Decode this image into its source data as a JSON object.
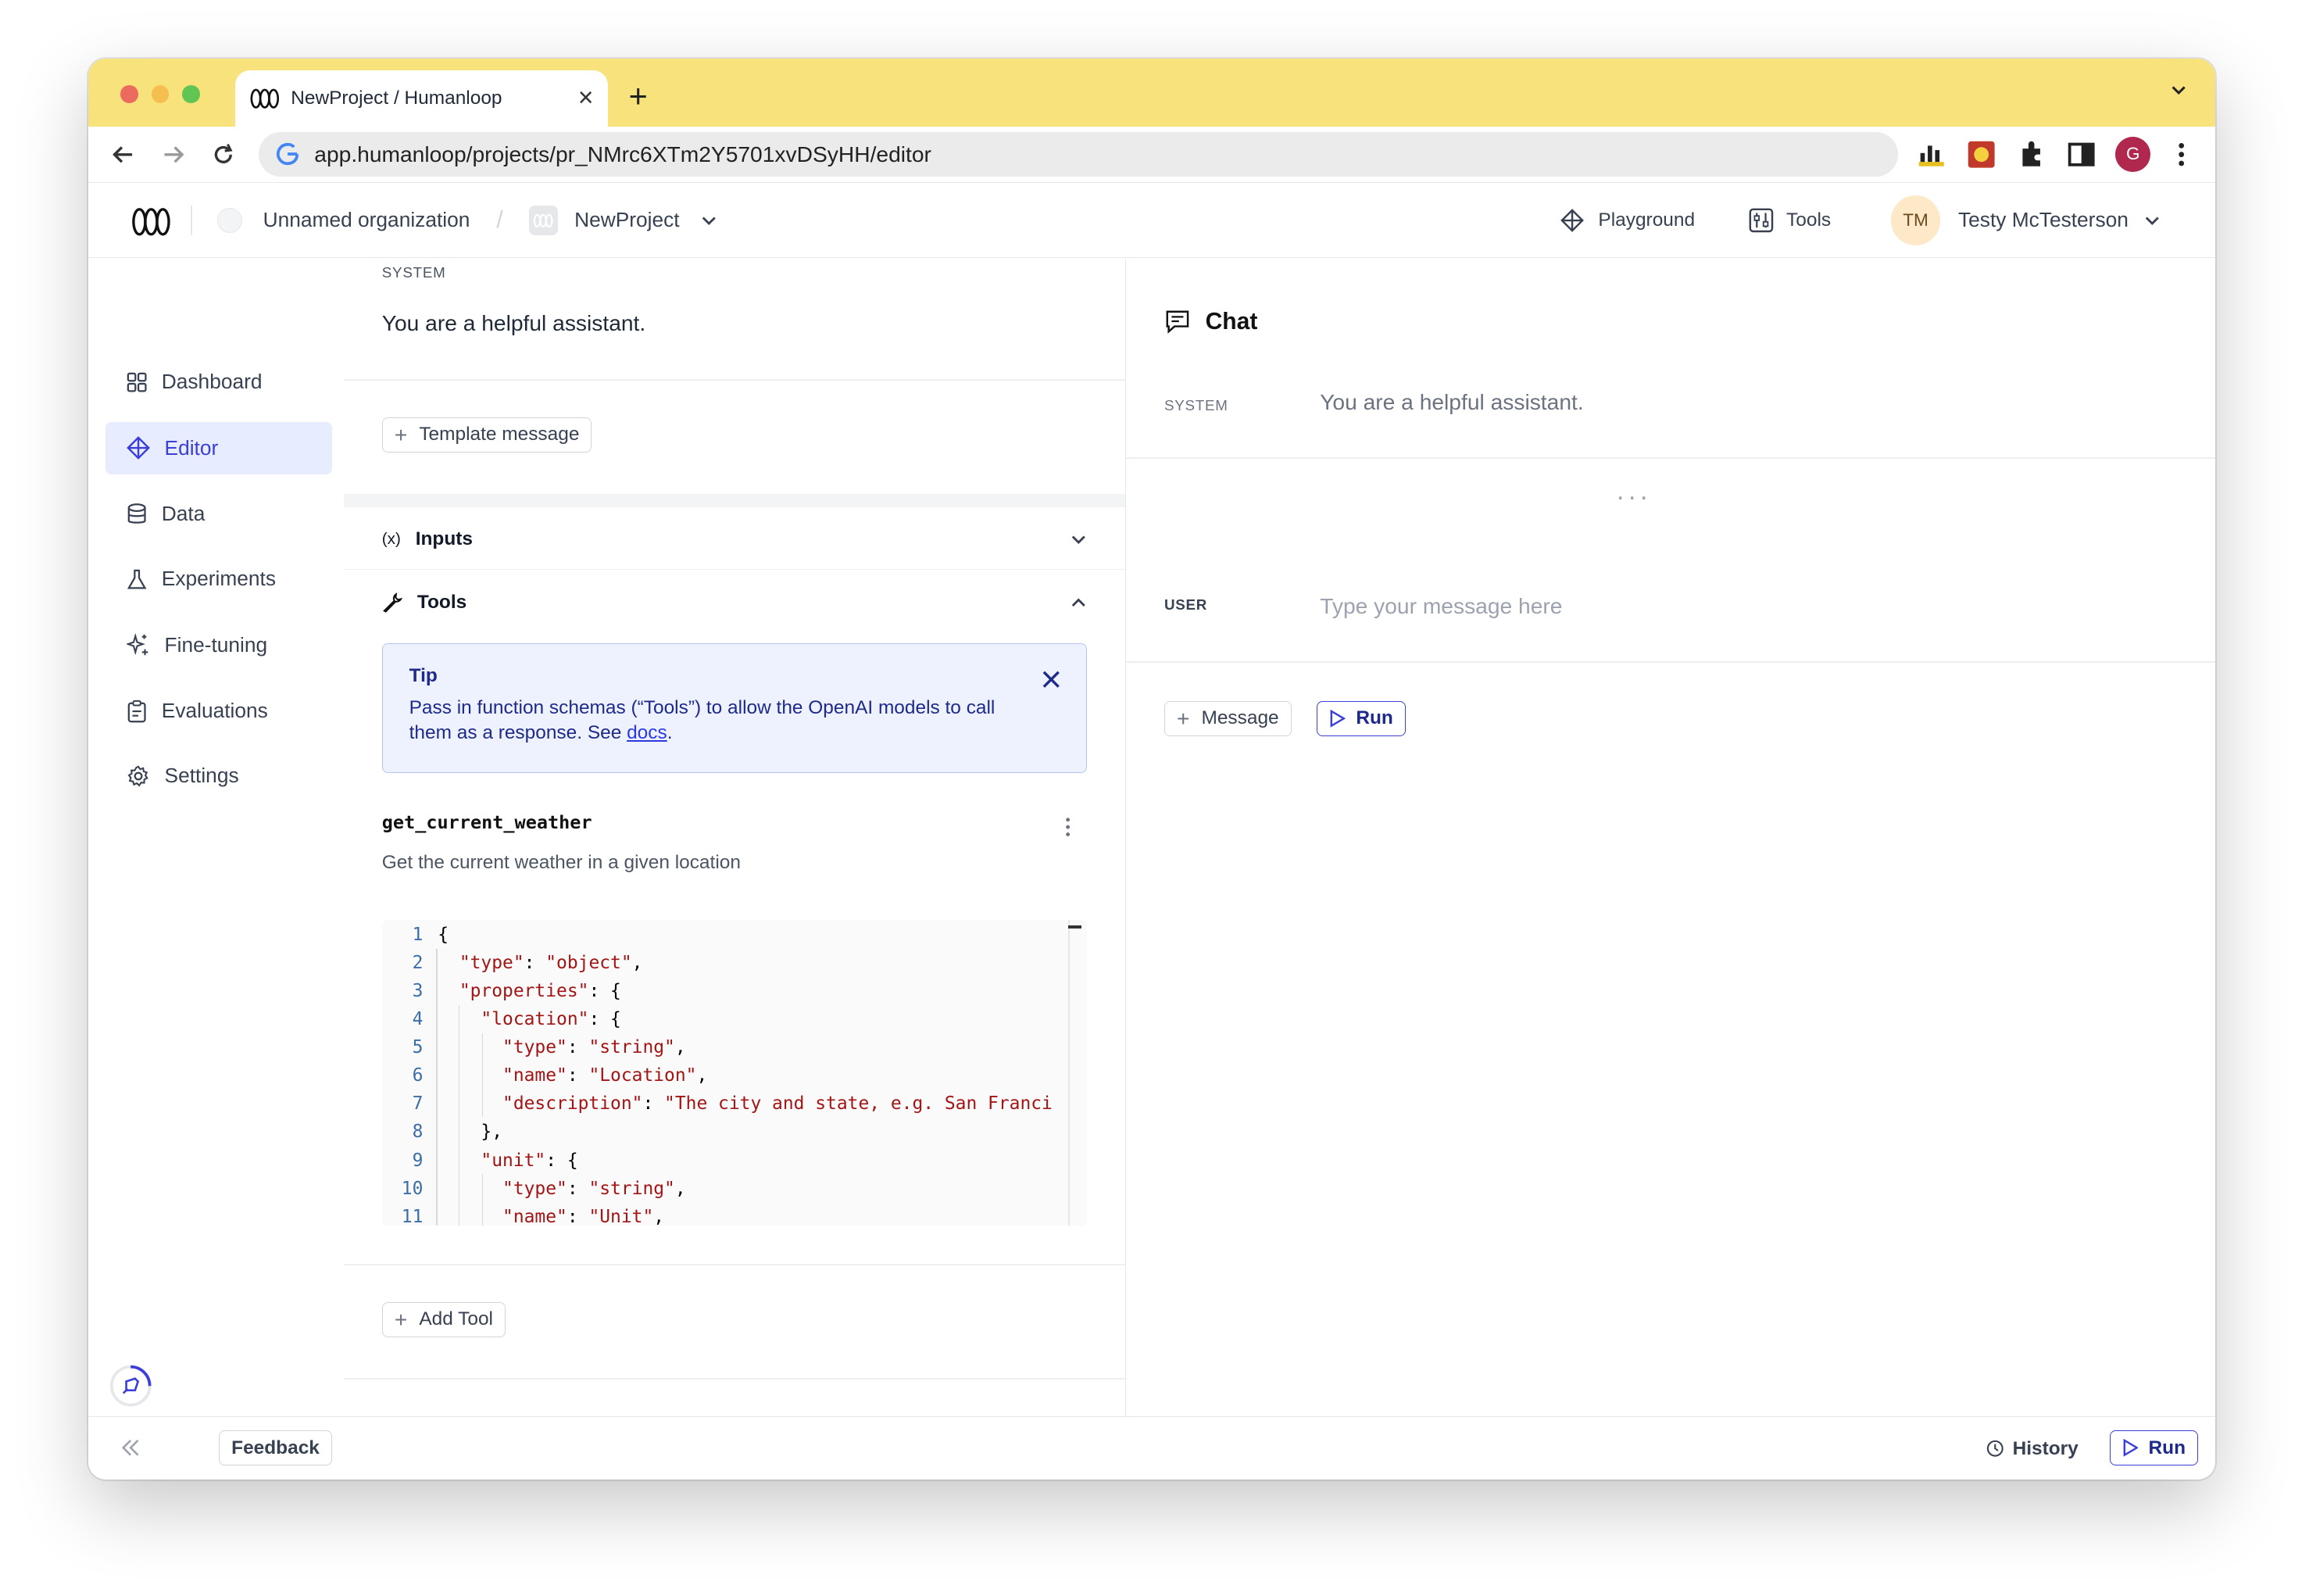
{
  "browser": {
    "tab_title": "NewProject / Humanloop",
    "url": "app.humanloop/projects/pr_NMrc6XTm2Y5701xvDSyHH/editor",
    "profile_initial": "G"
  },
  "header": {
    "org_name": "Unnamed organization",
    "separator": "/",
    "project_name": "NewProject",
    "playground_label": "Playground",
    "tools_label": "Tools",
    "user_initials": "TM",
    "user_name": "Testy McTesterson"
  },
  "sidebar": {
    "items": [
      {
        "label": "Dashboard"
      },
      {
        "label": "Editor"
      },
      {
        "label": "Data"
      },
      {
        "label": "Experiments"
      },
      {
        "label": "Fine-tuning"
      },
      {
        "label": "Evaluations"
      },
      {
        "label": "Settings"
      }
    ],
    "active": "Editor"
  },
  "editor": {
    "system_label": "SYSTEM",
    "system_text": "You are a helpful assistant.",
    "template_message_label": "Template message",
    "inputs_icon": "(x)",
    "inputs_label": "Inputs",
    "tools_label": "Tools",
    "tip": {
      "title": "Tip",
      "text": "Pass in function schemas (“Tools”) to allow the OpenAI models to call them as a response. See ",
      "link": "docs",
      "suffix": "."
    },
    "tool": {
      "name": "get_current_weather",
      "description": "Get the current weather in a given location"
    },
    "code_lines": [
      {
        "n": "1",
        "t": "{"
      },
      {
        "n": "2",
        "t": "  \"type\": \"object\","
      },
      {
        "n": "3",
        "t": "  \"properties\": {"
      },
      {
        "n": "4",
        "t": "    \"location\": {"
      },
      {
        "n": "5",
        "t": "      \"type\": \"string\","
      },
      {
        "n": "6",
        "t": "      \"name\": \"Location\","
      },
      {
        "n": "7",
        "t": "      \"description\": \"The city and state, e.g. San Franci"
      },
      {
        "n": "8",
        "t": "    },"
      },
      {
        "n": "9",
        "t": "    \"unit\": {"
      },
      {
        "n": "10",
        "t": "      \"type\": \"string\","
      },
      {
        "n": "11",
        "t": "      \"name\": \"Unit\","
      }
    ],
    "add_tool_label": "Add Tool"
  },
  "chat": {
    "title": "Chat",
    "system_label": "SYSTEM",
    "system_text": "You are a helpful assistant.",
    "ellipsis": "...",
    "user_label": "USER",
    "user_placeholder": "Type your message here",
    "message_button": "Message",
    "run_button": "Run"
  },
  "footer": {
    "feedback_label": "Feedback",
    "history_label": "History",
    "run_label": "Run"
  },
  "colors": {
    "tabbar": "#f8e27c",
    "accent": "#3b3fd8",
    "active_nav_bg": "#e7ecff",
    "tip_bg": "#eef2ff",
    "json_string": "#a31515"
  }
}
